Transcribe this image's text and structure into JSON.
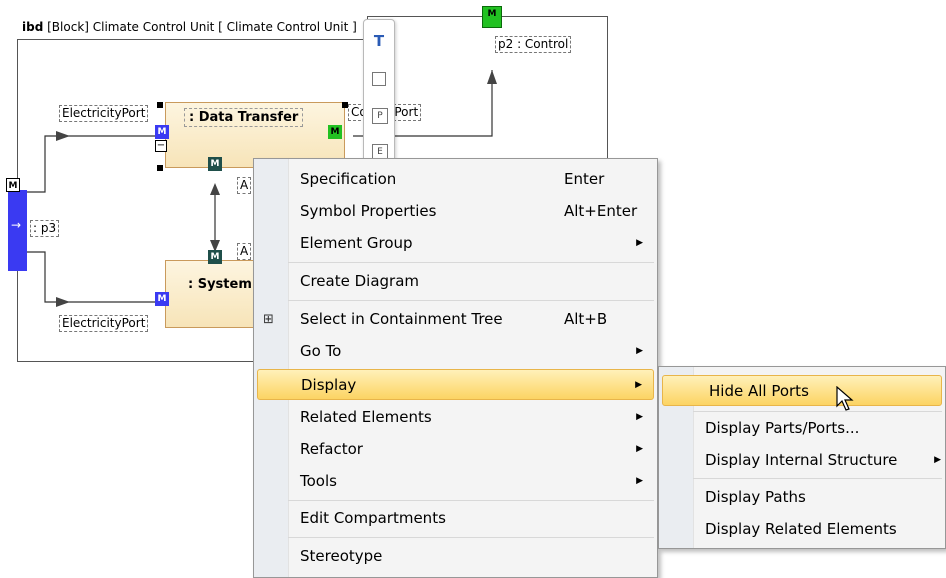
{
  "diagram": {
    "title_kind": "ibd",
    "title_rest": "[Block] Climate Control Unit [ Climate Control Unit ]",
    "ports": {
      "electricity_top": "ElectricityPort",
      "electricity_bottom": "ElectricityPort",
      "p3": ": p3",
      "p2": "p2 : Control",
      "control_port": "ControlPort",
      "a1": "A",
      "a2": "A"
    },
    "blocks": {
      "data_transfer": ": Data Transfer",
      "system": ": System"
    },
    "port_badge": "M",
    "colors": {
      "blue_port": "#3a3af2",
      "green_port": "#22c122",
      "dark_port": "#1f4f4a",
      "frame_border": "#555555",
      "accent_orange": "#f28b20"
    }
  },
  "toolbar": {
    "buttons": [
      "T",
      "frame",
      "P",
      "E"
    ]
  },
  "context_menu": {
    "items": [
      {
        "label": "Specification",
        "shortcut": "Enter",
        "submenu": false
      },
      {
        "label": "Symbol Properties",
        "shortcut": "Alt+Enter",
        "submenu": false
      },
      {
        "label": "Element Group",
        "shortcut": "",
        "submenu": true
      },
      {
        "label": "Create Diagram",
        "shortcut": "",
        "submenu": false
      },
      {
        "label": "Select in Containment Tree",
        "shortcut": "Alt+B",
        "submenu": false,
        "icon": "tree-icon"
      },
      {
        "label": "Go To",
        "shortcut": "",
        "submenu": true
      },
      {
        "label": "Display",
        "shortcut": "",
        "submenu": true,
        "highlighted": true
      },
      {
        "label": "Related Elements",
        "shortcut": "",
        "submenu": true
      },
      {
        "label": "Refactor",
        "shortcut": "",
        "submenu": true
      },
      {
        "label": "Tools",
        "shortcut": "",
        "submenu": true
      },
      {
        "label": "Edit Compartments",
        "shortcut": "",
        "submenu": false
      },
      {
        "label": "Stereotype",
        "shortcut": "",
        "submenu": false
      }
    ]
  },
  "display_submenu": {
    "items": [
      {
        "label": "Hide All Ports",
        "highlighted": true,
        "submenu": false
      },
      {
        "label": "Display Parts/Ports...",
        "submenu": false
      },
      {
        "label": "Display Internal Structure",
        "submenu": true
      },
      {
        "label": "Display Paths",
        "submenu": false
      },
      {
        "label": "Display Related Elements",
        "submenu": false
      }
    ]
  }
}
